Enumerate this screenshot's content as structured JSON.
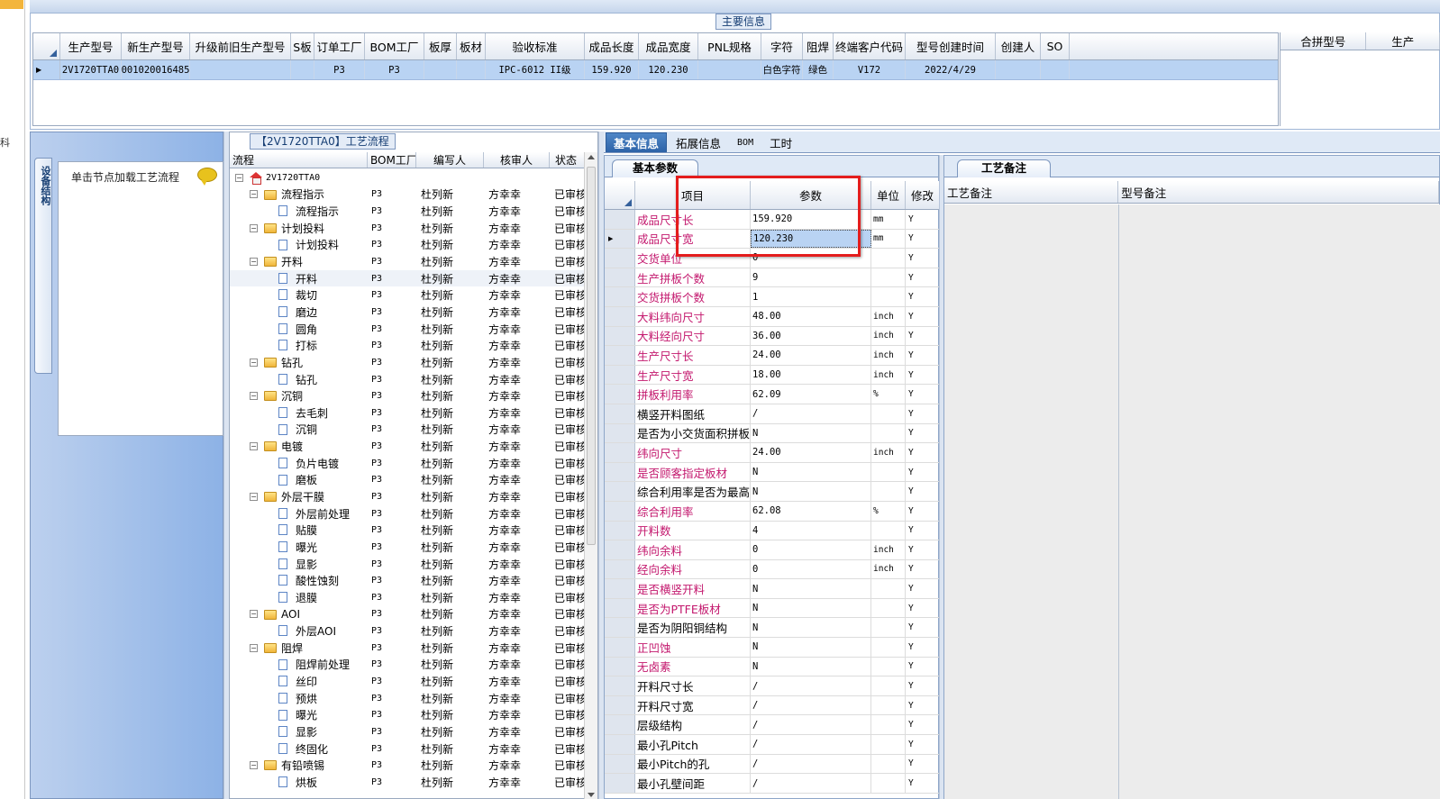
{
  "main_info": {
    "title": "主要信息",
    "columns": [
      "生产型号",
      "新生产型号",
      "升级前旧生产型号",
      "S板",
      "订单工厂",
      "BOM工厂",
      "板厚",
      "板材",
      "验收标准",
      "成品长度",
      "成品宽度",
      "PNL规格",
      "字符",
      "阻焊",
      "终端客户代码",
      "型号创建时间",
      "创建人",
      "SO"
    ],
    "row": [
      "2V1720TTA0",
      "10010200164853",
      "",
      "",
      "P3",
      "P3",
      "",
      "",
      "IPC-6012 II级",
      "159.920",
      "120.230",
      "",
      "白色字符",
      "绿色",
      "V172",
      "2022/4/29",
      "",
      ""
    ],
    "side_columns": [
      "合拼型号",
      "生产"
    ]
  },
  "left_panel": {
    "vertical_tab": "设备结构",
    "hint": "单击节点加载工艺流程"
  },
  "tree": {
    "title": "【2V1720TTA0】工艺流程",
    "columns": [
      "流程",
      "BOM工厂",
      "编写人",
      "核审人",
      "状态"
    ],
    "root": "2V1720TTA0",
    "rows": [
      {
        "level": 1,
        "type": "folder",
        "name": "流程指示",
        "bom": "P3",
        "writer": "杜列新",
        "reviewer": "方幸幸",
        "status": "已审核"
      },
      {
        "level": 2,
        "type": "doc",
        "name": "流程指示",
        "bom": "P3",
        "writer": "杜列新",
        "reviewer": "方幸幸",
        "status": "已审核"
      },
      {
        "level": 1,
        "type": "folder",
        "name": "计划投料",
        "bom": "P3",
        "writer": "杜列新",
        "reviewer": "方幸幸",
        "status": "已审核"
      },
      {
        "level": 2,
        "type": "doc",
        "name": "计划投料",
        "bom": "P3",
        "writer": "杜列新",
        "reviewer": "方幸幸",
        "status": "已审核"
      },
      {
        "level": 1,
        "type": "folder",
        "name": "开料",
        "bom": "P3",
        "writer": "杜列新",
        "reviewer": "方幸幸",
        "status": "已审核"
      },
      {
        "level": 2,
        "type": "doc",
        "name": "开料",
        "bom": "P3",
        "writer": "杜列新",
        "reviewer": "方幸幸",
        "status": "已审核",
        "selected": true
      },
      {
        "level": 2,
        "type": "doc",
        "name": "裁切",
        "bom": "P3",
        "writer": "杜列新",
        "reviewer": "方幸幸",
        "status": "已审核"
      },
      {
        "level": 2,
        "type": "doc",
        "name": "磨边",
        "bom": "P3",
        "writer": "杜列新",
        "reviewer": "方幸幸",
        "status": "已审核"
      },
      {
        "level": 2,
        "type": "doc",
        "name": "圆角",
        "bom": "P3",
        "writer": "杜列新",
        "reviewer": "方幸幸",
        "status": "已审核"
      },
      {
        "level": 2,
        "type": "doc",
        "name": "打标",
        "bom": "P3",
        "writer": "杜列新",
        "reviewer": "方幸幸",
        "status": "已审核"
      },
      {
        "level": 1,
        "type": "folder",
        "name": "钻孔",
        "bom": "P3",
        "writer": "杜列新",
        "reviewer": "方幸幸",
        "status": "已审核"
      },
      {
        "level": 2,
        "type": "doc",
        "name": "钻孔",
        "bom": "P3",
        "writer": "杜列新",
        "reviewer": "方幸幸",
        "status": "已审核"
      },
      {
        "level": 1,
        "type": "folder",
        "name": "沉铜",
        "bom": "P3",
        "writer": "杜列新",
        "reviewer": "方幸幸",
        "status": "已审核"
      },
      {
        "level": 2,
        "type": "doc",
        "name": "去毛刺",
        "bom": "P3",
        "writer": "杜列新",
        "reviewer": "方幸幸",
        "status": "已审核"
      },
      {
        "level": 2,
        "type": "doc",
        "name": "沉铜",
        "bom": "P3",
        "writer": "杜列新",
        "reviewer": "方幸幸",
        "status": "已审核"
      },
      {
        "level": 1,
        "type": "folder",
        "name": "电镀",
        "bom": "P3",
        "writer": "杜列新",
        "reviewer": "方幸幸",
        "status": "已审核"
      },
      {
        "level": 2,
        "type": "doc",
        "name": "负片电镀",
        "bom": "P3",
        "writer": "杜列新",
        "reviewer": "方幸幸",
        "status": "已审核"
      },
      {
        "level": 2,
        "type": "doc",
        "name": "磨板",
        "bom": "P3",
        "writer": "杜列新",
        "reviewer": "方幸幸",
        "status": "已审核"
      },
      {
        "level": 1,
        "type": "folder",
        "name": "外层干膜",
        "bom": "P3",
        "writer": "杜列新",
        "reviewer": "方幸幸",
        "status": "已审核"
      },
      {
        "level": 2,
        "type": "doc",
        "name": "外层前处理",
        "bom": "P3",
        "writer": "杜列新",
        "reviewer": "方幸幸",
        "status": "已审核"
      },
      {
        "level": 2,
        "type": "doc",
        "name": "贴膜",
        "bom": "P3",
        "writer": "杜列新",
        "reviewer": "方幸幸",
        "status": "已审核"
      },
      {
        "level": 2,
        "type": "doc",
        "name": "曝光",
        "bom": "P3",
        "writer": "杜列新",
        "reviewer": "方幸幸",
        "status": "已审核"
      },
      {
        "level": 2,
        "type": "doc",
        "name": "显影",
        "bom": "P3",
        "writer": "杜列新",
        "reviewer": "方幸幸",
        "status": "已审核"
      },
      {
        "level": 2,
        "type": "doc",
        "name": "酸性蚀刻",
        "bom": "P3",
        "writer": "杜列新",
        "reviewer": "方幸幸",
        "status": "已审核"
      },
      {
        "level": 2,
        "type": "doc",
        "name": "退膜",
        "bom": "P3",
        "writer": "杜列新",
        "reviewer": "方幸幸",
        "status": "已审核"
      },
      {
        "level": 1,
        "type": "folder",
        "name": "AOI",
        "bom": "P3",
        "writer": "杜列新",
        "reviewer": "方幸幸",
        "status": "已审核"
      },
      {
        "level": 2,
        "type": "doc",
        "name": "外层AOI",
        "bom": "P3",
        "writer": "杜列新",
        "reviewer": "方幸幸",
        "status": "已审核"
      },
      {
        "level": 1,
        "type": "folder",
        "name": "阻焊",
        "bom": "P3",
        "writer": "杜列新",
        "reviewer": "方幸幸",
        "status": "已审核"
      },
      {
        "level": 2,
        "type": "doc",
        "name": "阻焊前处理",
        "bom": "P3",
        "writer": "杜列新",
        "reviewer": "方幸幸",
        "status": "已审核"
      },
      {
        "level": 2,
        "type": "doc",
        "name": "丝印",
        "bom": "P3",
        "writer": "杜列新",
        "reviewer": "方幸幸",
        "status": "已审核"
      },
      {
        "level": 2,
        "type": "doc",
        "name": "预烘",
        "bom": "P3",
        "writer": "杜列新",
        "reviewer": "方幸幸",
        "status": "已审核"
      },
      {
        "level": 2,
        "type": "doc",
        "name": "曝光",
        "bom": "P3",
        "writer": "杜列新",
        "reviewer": "方幸幸",
        "status": "已审核"
      },
      {
        "level": 2,
        "type": "doc",
        "name": "显影",
        "bom": "P3",
        "writer": "杜列新",
        "reviewer": "方幸幸",
        "status": "已审核"
      },
      {
        "level": 2,
        "type": "doc",
        "name": "终固化",
        "bom": "P3",
        "writer": "杜列新",
        "reviewer": "方幸幸",
        "status": "已审核"
      },
      {
        "level": 1,
        "type": "folder",
        "name": "有铅喷锡",
        "bom": "P3",
        "writer": "杜列新",
        "reviewer": "方幸幸",
        "status": "已审核"
      },
      {
        "level": 2,
        "type": "doc",
        "name": "烘板",
        "bom": "P3",
        "writer": "杜列新",
        "reviewer": "方幸幸",
        "status": "已审核"
      }
    ]
  },
  "tabs": [
    "基本信息",
    "拓展信息",
    "BOM",
    "工时"
  ],
  "basic": {
    "subtab": "基本参数",
    "columns": [
      "项目",
      "参数",
      "单位",
      "修改"
    ],
    "rows": [
      {
        "item": "成品尺寸长",
        "value": "159.920",
        "unit": "mm",
        "mod": "Y",
        "pink": true
      },
      {
        "item": "成品尺寸宽",
        "value": "120.230",
        "unit": "mm",
        "mod": "Y",
        "pink": true,
        "current": true
      },
      {
        "item": "交货单位",
        "value": "0",
        "unit": "",
        "mod": "Y",
        "pink": true
      },
      {
        "item": "生产拼板个数",
        "value": "9",
        "unit": "",
        "mod": "Y",
        "pink": true
      },
      {
        "item": "交货拼板个数",
        "value": "1",
        "unit": "",
        "mod": "Y",
        "pink": true
      },
      {
        "item": "大料纬向尺寸",
        "value": "48.00",
        "unit": "inch",
        "mod": "Y",
        "pink": true
      },
      {
        "item": "大料经向尺寸",
        "value": "36.00",
        "unit": "inch",
        "mod": "Y",
        "pink": true
      },
      {
        "item": "生产尺寸长",
        "value": "24.00",
        "unit": "inch",
        "mod": "Y",
        "pink": true
      },
      {
        "item": "生产尺寸宽",
        "value": "18.00",
        "unit": "inch",
        "mod": "Y",
        "pink": true
      },
      {
        "item": "拼板利用率",
        "value": "62.09",
        "unit": "%",
        "mod": "Y",
        "pink": true
      },
      {
        "item": "横竖开料图纸",
        "value": "/",
        "unit": "",
        "mod": "Y",
        "pink": false
      },
      {
        "item": "是否为小交货面积拼板",
        "value": "N",
        "unit": "",
        "mod": "Y",
        "pink": false
      },
      {
        "item": "纬向尺寸",
        "value": "24.00",
        "unit": "inch",
        "mod": "Y",
        "pink": true
      },
      {
        "item": "是否顾客指定板材",
        "value": "N",
        "unit": "",
        "mod": "Y",
        "pink": true
      },
      {
        "item": "综合利用率是否为最高",
        "value": "N",
        "unit": "",
        "mod": "Y",
        "pink": false
      },
      {
        "item": "综合利用率",
        "value": "62.08",
        "unit": "%",
        "mod": "Y",
        "pink": true
      },
      {
        "item": "开料数",
        "value": "4",
        "unit": "",
        "mod": "Y",
        "pink": true
      },
      {
        "item": "纬向余料",
        "value": "0",
        "unit": "inch",
        "mod": "Y",
        "pink": true
      },
      {
        "item": "经向余料",
        "value": "0",
        "unit": "inch",
        "mod": "Y",
        "pink": true
      },
      {
        "item": "是否横竖开料",
        "value": "N",
        "unit": "",
        "mod": "Y",
        "pink": true
      },
      {
        "item": "是否为PTFE板材",
        "value": "N",
        "unit": "",
        "mod": "Y",
        "pink": true
      },
      {
        "item": "是否为阴阳铜结构",
        "value": "N",
        "unit": "",
        "mod": "Y",
        "pink": false
      },
      {
        "item": "正凹蚀",
        "value": "N",
        "unit": "",
        "mod": "Y",
        "pink": true
      },
      {
        "item": "无卤素",
        "value": "N",
        "unit": "",
        "mod": "Y",
        "pink": true
      },
      {
        "item": "开料尺寸长",
        "value": "/",
        "unit": "",
        "mod": "Y",
        "pink": false
      },
      {
        "item": "开料尺寸宽",
        "value": "/",
        "unit": "",
        "mod": "Y",
        "pink": false
      },
      {
        "item": "层级结构",
        "value": "/",
        "unit": "",
        "mod": "Y",
        "pink": false
      },
      {
        "item": "最小孔Pitch",
        "value": "/",
        "unit": "",
        "mod": "Y",
        "pink": false
      },
      {
        "item": "最小Pitch的孔",
        "value": "/",
        "unit": "",
        "mod": "Y",
        "pink": false
      },
      {
        "item": "最小孔壁间距",
        "value": "/",
        "unit": "",
        "mod": "Y",
        "pink": false
      }
    ]
  },
  "notes": {
    "subtab": "工艺备注",
    "columns": [
      "工艺备注",
      "型号备注"
    ]
  }
}
